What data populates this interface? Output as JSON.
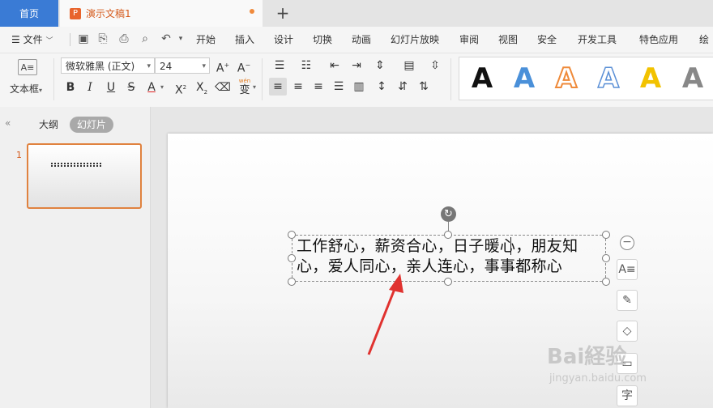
{
  "tabs": {
    "home": "首页",
    "document": "演示文稿1",
    "add": "+"
  },
  "menu": {
    "file": "文件",
    "items": [
      "开始",
      "插入",
      "设计",
      "切换",
      "动画",
      "幻灯片放映",
      "审阅",
      "视图",
      "安全",
      "开发工具",
      "特色应用",
      "绘图"
    ]
  },
  "ribbon": {
    "textbox_label": "文本框",
    "font_name": "微软雅黑 (正文)",
    "font_size": "24",
    "phonetic": "wén",
    "style_letter": "A"
  },
  "left_panel": {
    "outline_tab": "大纲",
    "slides_tab": "幻灯片",
    "slide_number": "1"
  },
  "slide": {
    "text": "工作舒心，薪资合心，日子暖心，朋友知心，爱人同心，亲人连心，事事都称心"
  },
  "floating_tools": {
    "last_label": "字"
  },
  "watermark": {
    "brand": "Bai経验",
    "url": "jingyan.baidu.com"
  },
  "colors": {
    "accent_blue": "#3a7bd5",
    "accent_orange": "#e8642c",
    "arrow_red": "#e0322f"
  }
}
